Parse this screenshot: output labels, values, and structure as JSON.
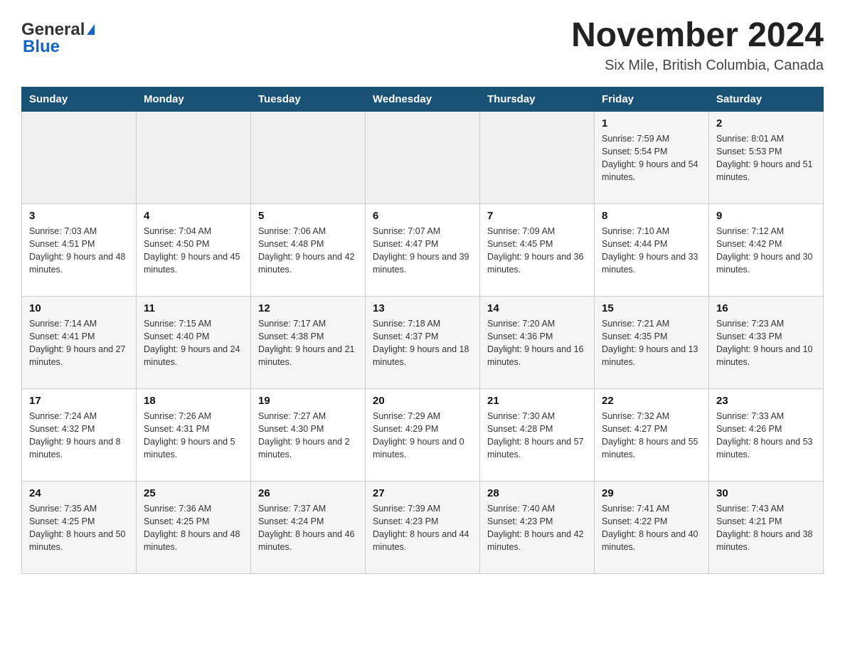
{
  "header": {
    "logo_general": "General",
    "logo_blue": "Blue",
    "month_year": "November 2024",
    "location": "Six Mile, British Columbia, Canada"
  },
  "weekdays": [
    "Sunday",
    "Monday",
    "Tuesday",
    "Wednesday",
    "Thursday",
    "Friday",
    "Saturday"
  ],
  "weeks": [
    [
      {
        "day": "",
        "sunrise": "",
        "sunset": "",
        "daylight": ""
      },
      {
        "day": "",
        "sunrise": "",
        "sunset": "",
        "daylight": ""
      },
      {
        "day": "",
        "sunrise": "",
        "sunset": "",
        "daylight": ""
      },
      {
        "day": "",
        "sunrise": "",
        "sunset": "",
        "daylight": ""
      },
      {
        "day": "",
        "sunrise": "",
        "sunset": "",
        "daylight": ""
      },
      {
        "day": "1",
        "sunrise": "Sunrise: 7:59 AM",
        "sunset": "Sunset: 5:54 PM",
        "daylight": "Daylight: 9 hours and 54 minutes."
      },
      {
        "day": "2",
        "sunrise": "Sunrise: 8:01 AM",
        "sunset": "Sunset: 5:53 PM",
        "daylight": "Daylight: 9 hours and 51 minutes."
      }
    ],
    [
      {
        "day": "3",
        "sunrise": "Sunrise: 7:03 AM",
        "sunset": "Sunset: 4:51 PM",
        "daylight": "Daylight: 9 hours and 48 minutes."
      },
      {
        "day": "4",
        "sunrise": "Sunrise: 7:04 AM",
        "sunset": "Sunset: 4:50 PM",
        "daylight": "Daylight: 9 hours and 45 minutes."
      },
      {
        "day": "5",
        "sunrise": "Sunrise: 7:06 AM",
        "sunset": "Sunset: 4:48 PM",
        "daylight": "Daylight: 9 hours and 42 minutes."
      },
      {
        "day": "6",
        "sunrise": "Sunrise: 7:07 AM",
        "sunset": "Sunset: 4:47 PM",
        "daylight": "Daylight: 9 hours and 39 minutes."
      },
      {
        "day": "7",
        "sunrise": "Sunrise: 7:09 AM",
        "sunset": "Sunset: 4:45 PM",
        "daylight": "Daylight: 9 hours and 36 minutes."
      },
      {
        "day": "8",
        "sunrise": "Sunrise: 7:10 AM",
        "sunset": "Sunset: 4:44 PM",
        "daylight": "Daylight: 9 hours and 33 minutes."
      },
      {
        "day": "9",
        "sunrise": "Sunrise: 7:12 AM",
        "sunset": "Sunset: 4:42 PM",
        "daylight": "Daylight: 9 hours and 30 minutes."
      }
    ],
    [
      {
        "day": "10",
        "sunrise": "Sunrise: 7:14 AM",
        "sunset": "Sunset: 4:41 PM",
        "daylight": "Daylight: 9 hours and 27 minutes."
      },
      {
        "day": "11",
        "sunrise": "Sunrise: 7:15 AM",
        "sunset": "Sunset: 4:40 PM",
        "daylight": "Daylight: 9 hours and 24 minutes."
      },
      {
        "day": "12",
        "sunrise": "Sunrise: 7:17 AM",
        "sunset": "Sunset: 4:38 PM",
        "daylight": "Daylight: 9 hours and 21 minutes."
      },
      {
        "day": "13",
        "sunrise": "Sunrise: 7:18 AM",
        "sunset": "Sunset: 4:37 PM",
        "daylight": "Daylight: 9 hours and 18 minutes."
      },
      {
        "day": "14",
        "sunrise": "Sunrise: 7:20 AM",
        "sunset": "Sunset: 4:36 PM",
        "daylight": "Daylight: 9 hours and 16 minutes."
      },
      {
        "day": "15",
        "sunrise": "Sunrise: 7:21 AM",
        "sunset": "Sunset: 4:35 PM",
        "daylight": "Daylight: 9 hours and 13 minutes."
      },
      {
        "day": "16",
        "sunrise": "Sunrise: 7:23 AM",
        "sunset": "Sunset: 4:33 PM",
        "daylight": "Daylight: 9 hours and 10 minutes."
      }
    ],
    [
      {
        "day": "17",
        "sunrise": "Sunrise: 7:24 AM",
        "sunset": "Sunset: 4:32 PM",
        "daylight": "Daylight: 9 hours and 8 minutes."
      },
      {
        "day": "18",
        "sunrise": "Sunrise: 7:26 AM",
        "sunset": "Sunset: 4:31 PM",
        "daylight": "Daylight: 9 hours and 5 minutes."
      },
      {
        "day": "19",
        "sunrise": "Sunrise: 7:27 AM",
        "sunset": "Sunset: 4:30 PM",
        "daylight": "Daylight: 9 hours and 2 minutes."
      },
      {
        "day": "20",
        "sunrise": "Sunrise: 7:29 AM",
        "sunset": "Sunset: 4:29 PM",
        "daylight": "Daylight: 9 hours and 0 minutes."
      },
      {
        "day": "21",
        "sunrise": "Sunrise: 7:30 AM",
        "sunset": "Sunset: 4:28 PM",
        "daylight": "Daylight: 8 hours and 57 minutes."
      },
      {
        "day": "22",
        "sunrise": "Sunrise: 7:32 AM",
        "sunset": "Sunset: 4:27 PM",
        "daylight": "Daylight: 8 hours and 55 minutes."
      },
      {
        "day": "23",
        "sunrise": "Sunrise: 7:33 AM",
        "sunset": "Sunset: 4:26 PM",
        "daylight": "Daylight: 8 hours and 53 minutes."
      }
    ],
    [
      {
        "day": "24",
        "sunrise": "Sunrise: 7:35 AM",
        "sunset": "Sunset: 4:25 PM",
        "daylight": "Daylight: 8 hours and 50 minutes."
      },
      {
        "day": "25",
        "sunrise": "Sunrise: 7:36 AM",
        "sunset": "Sunset: 4:25 PM",
        "daylight": "Daylight: 8 hours and 48 minutes."
      },
      {
        "day": "26",
        "sunrise": "Sunrise: 7:37 AM",
        "sunset": "Sunset: 4:24 PM",
        "daylight": "Daylight: 8 hours and 46 minutes."
      },
      {
        "day": "27",
        "sunrise": "Sunrise: 7:39 AM",
        "sunset": "Sunset: 4:23 PM",
        "daylight": "Daylight: 8 hours and 44 minutes."
      },
      {
        "day": "28",
        "sunrise": "Sunrise: 7:40 AM",
        "sunset": "Sunset: 4:23 PM",
        "daylight": "Daylight: 8 hours and 42 minutes."
      },
      {
        "day": "29",
        "sunrise": "Sunrise: 7:41 AM",
        "sunset": "Sunset: 4:22 PM",
        "daylight": "Daylight: 8 hours and 40 minutes."
      },
      {
        "day": "30",
        "sunrise": "Sunrise: 7:43 AM",
        "sunset": "Sunset: 4:21 PM",
        "daylight": "Daylight: 8 hours and 38 minutes."
      }
    ]
  ]
}
